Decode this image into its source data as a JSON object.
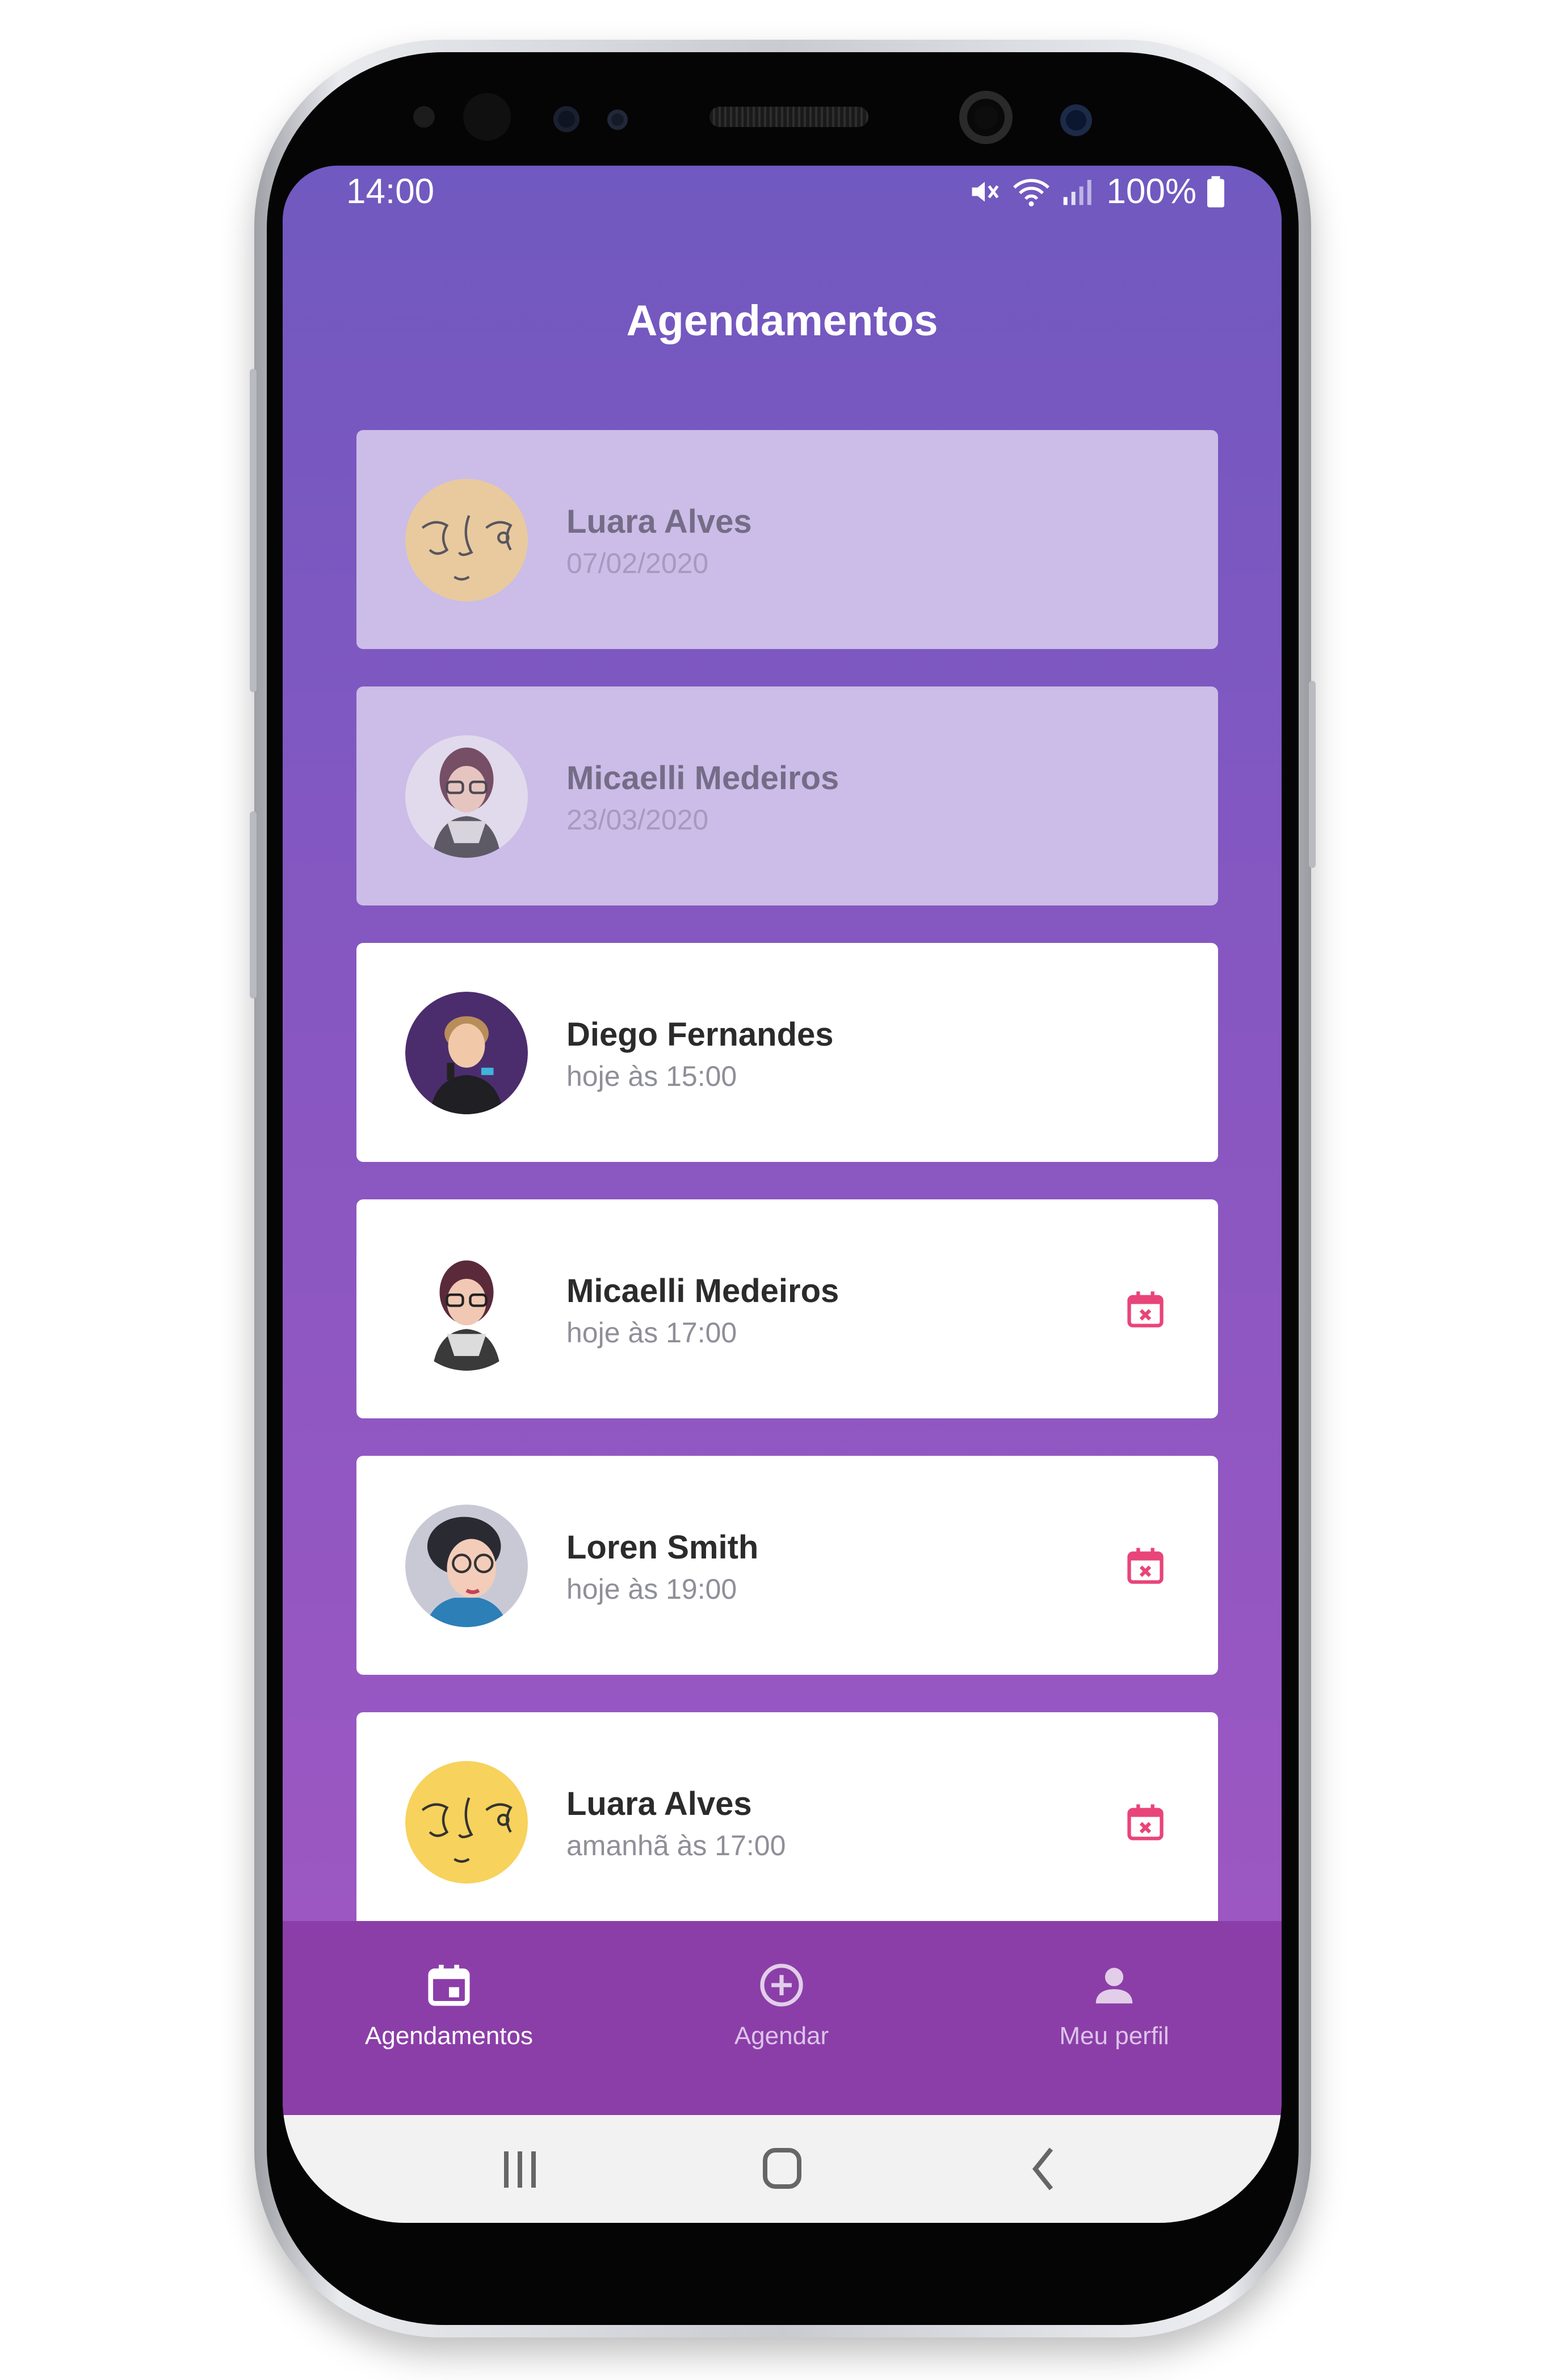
{
  "status_bar": {
    "time": "14:00",
    "battery": "100%",
    "icons": [
      "mute-icon",
      "wifi-icon",
      "signal-icon",
      "battery-icon"
    ]
  },
  "header": {
    "title": "Agendamentos"
  },
  "appointments": [
    {
      "name": "Luara Alves",
      "when": "07/02/2020",
      "state": "past",
      "avatar": "sketch-face"
    },
    {
      "name": "Micaelli Medeiros",
      "when": "23/03/2020",
      "state": "past",
      "avatar": "woman-glasses"
    },
    {
      "name": "Diego Fernandes",
      "when": "hoje às 15:00",
      "state": "upcoming",
      "avatar": "man-microphone"
    },
    {
      "name": "Micaelli Medeiros",
      "when": "hoje às 17:00",
      "state": "upcoming",
      "avatar": "woman-glasses",
      "cancel_icon": "calendar-cancel-icon"
    },
    {
      "name": "Loren Smith",
      "when": "hoje às 19:00",
      "state": "upcoming",
      "avatar": "woman-curly-hair",
      "cancel_icon": "calendar-cancel-icon"
    },
    {
      "name": "Luara Alves",
      "when": "amanhã às 17:00",
      "state": "upcoming",
      "avatar": "sketch-face",
      "cancel_icon": "calendar-cancel-icon"
    }
  ],
  "tabs": [
    {
      "label": "Agendamentos",
      "icon": "calendar-icon",
      "active": true
    },
    {
      "label": "Agendar",
      "icon": "add-circle-icon",
      "active": false
    },
    {
      "label": "Meu perfil",
      "icon": "person-icon",
      "active": false
    }
  ],
  "system_nav": [
    "recent-apps-icon",
    "home-icon",
    "back-icon"
  ],
  "colors": {
    "gradient_top": "#7059c0",
    "gradient_bottom": "#a357c2",
    "past_card": "#cbbde7",
    "tab_bar": "#8b3ea8",
    "cancel_accent": "#e8457a"
  }
}
